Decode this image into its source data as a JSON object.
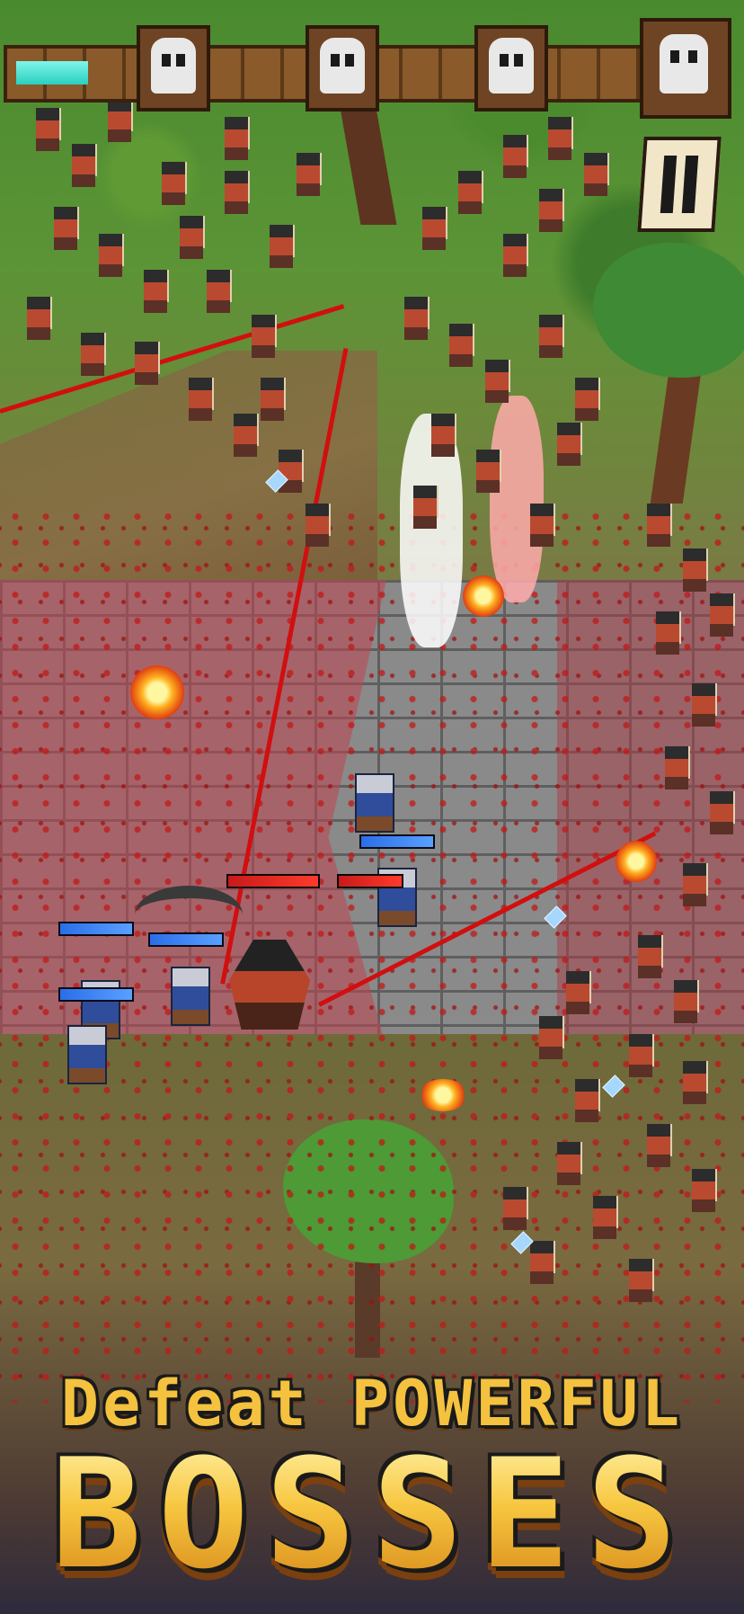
{
  "hud": {
    "wave_progress": 0.1,
    "boss_markers": [
      "skull-icon",
      "skull-icon",
      "skull-icon",
      "skull-icon"
    ],
    "pause_icon": "pause-icon"
  },
  "promo": {
    "line1": "Defeat POWERFUL",
    "line2": "BOSSES"
  },
  "units": {
    "hero_health": [
      1.0,
      1.0,
      1.0,
      1.0,
      1.0
    ],
    "boss_health": [
      1.0,
      1.0
    ]
  },
  "colors": {
    "accent_gold": "#f4c23e",
    "hero_bar": "#2a6ee8",
    "boss_bar": "#c81a1a",
    "blood": "#c21818"
  }
}
